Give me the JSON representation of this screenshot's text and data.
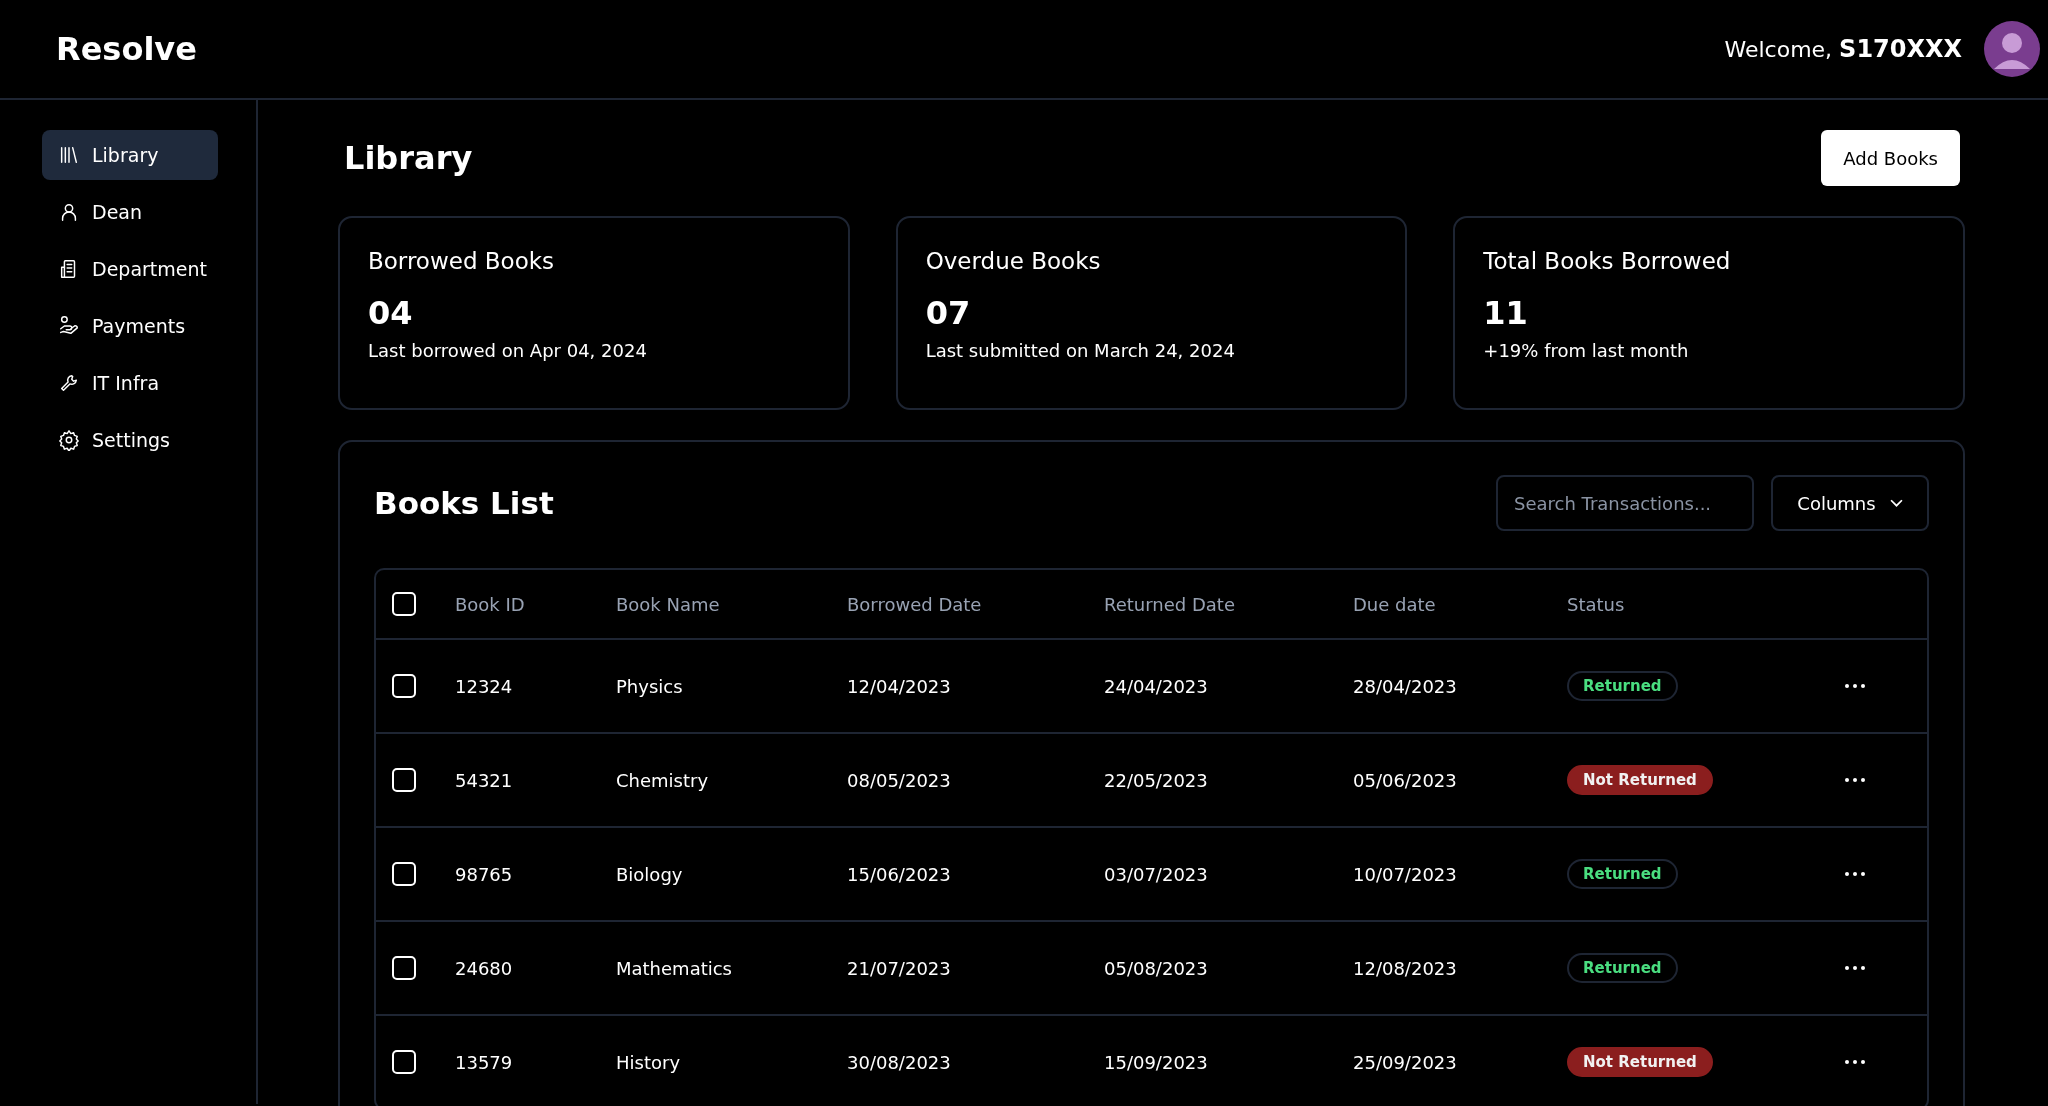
{
  "brand": "Resolve",
  "user": {
    "greeting": "Welcome,",
    "name": "S170XXX"
  },
  "sidebar": {
    "items": [
      {
        "label": "Library",
        "selected": true
      },
      {
        "label": "Dean",
        "selected": false
      },
      {
        "label": "Department",
        "selected": false
      },
      {
        "label": "Payments",
        "selected": false
      },
      {
        "label": "IT Infra",
        "selected": false
      },
      {
        "label": "Settings",
        "selected": false
      }
    ]
  },
  "page": {
    "title": "Library",
    "action": "Add Books"
  },
  "cards": [
    {
      "title": "Borrowed Books",
      "value": "04",
      "note": "Last borrowed on Apr 04, 2024"
    },
    {
      "title": "Overdue Books",
      "value": "07",
      "note": "Last submitted on March 24, 2024"
    },
    {
      "title": "Total Books Borrowed",
      "value": "11",
      "note": "+19% from last month"
    }
  ],
  "books_list": {
    "title": "Books List",
    "search": {
      "placeholder": "Search Transactions..."
    },
    "columns_button": "Columns",
    "table": {
      "header_checked": false,
      "columns": [
        "Book ID",
        "Book Name",
        "Borrowed Date",
        "Returned Date",
        "Due date",
        "Status"
      ],
      "rows": [
        {
          "checked": false,
          "cells": [
            "12324",
            "Physics",
            "12/04/2023",
            "24/04/2023",
            "28/04/2023"
          ],
          "status": {
            "kind": "returned",
            "label": "Returned"
          }
        },
        {
          "checked": false,
          "cells": [
            "54321",
            "Chemistry",
            "08/05/2023",
            "22/05/2023",
            "05/06/2023"
          ],
          "status": {
            "kind": "not_returned",
            "label": "Not Returned"
          }
        },
        {
          "checked": false,
          "cells": [
            "98765",
            "Biology",
            "15/06/2023",
            "03/07/2023",
            "10/07/2023"
          ],
          "status": {
            "kind": "returned",
            "label": "Returned"
          }
        },
        {
          "checked": false,
          "cells": [
            "24680",
            "Mathematics",
            "21/07/2023",
            "05/08/2023",
            "12/08/2023"
          ],
          "status": {
            "kind": "returned",
            "label": "Returned"
          }
        },
        {
          "checked": false,
          "cells": [
            "13579",
            "History",
            "30/08/2023",
            "15/09/2023",
            "25/09/2023"
          ],
          "status": {
            "kind": "not_returned",
            "label": "Not Returned"
          }
        }
      ]
    }
  }
}
